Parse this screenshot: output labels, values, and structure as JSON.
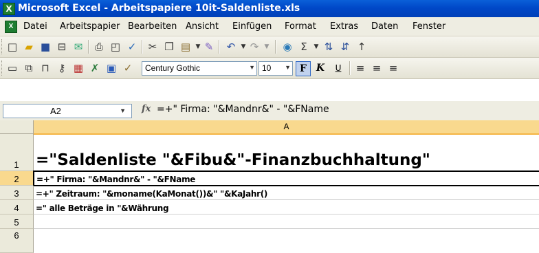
{
  "window": {
    "title": "Microsoft Excel - Arbeitspapiere 10it-Saldenliste.xls",
    "app_logo": "X",
    "doc_logo": "X"
  },
  "menu": [
    "Datei",
    "Arbeitspapier",
    "Bearbeiten",
    "Ansicht",
    "Einfügen",
    "Format",
    "Extras",
    "Daten",
    "Fenster"
  ],
  "toolbar_standard": {
    "icons": [
      "new-icon",
      "open-icon",
      "save-icon",
      "permission-icon",
      "email-icon",
      "print-icon",
      "print-preview-icon",
      "spelling-icon",
      "cut-icon",
      "copy-icon",
      "paste-icon",
      "format-painter-icon",
      "undo-icon",
      "redo-icon",
      "hyperlink-icon",
      "autosum-icon",
      "sort-asc-icon",
      "sort-desc-icon"
    ],
    "autosum_glyph": "Σ"
  },
  "toolbar_format": {
    "font_name": "Century Gothic",
    "font_size": "10",
    "bold": "F",
    "italic": "K",
    "underline": "U"
  },
  "formula_bar": {
    "name_box": "A2",
    "fx": "fx",
    "formula": "=+\" Firma: \"&Mandnr&\" - \"&FName"
  },
  "sheet": {
    "column_headers": [
      "A"
    ],
    "rows": [
      {
        "num": "1",
        "value": "=\"Saldenliste \"&Fibu&\"-Finanzbuchhaltung\""
      },
      {
        "num": "2",
        "value": "=+\" Firma: \"&Mandnr&\" - \"&FName"
      },
      {
        "num": "3",
        "value": "=+\" Zeitraum: \"&moname(KaMonat())&\" \"&KaJahr()"
      },
      {
        "num": "4",
        "value": "=\" alle Beträge in \"&Währung"
      },
      {
        "num": "5",
        "value": ""
      },
      {
        "num": "6",
        "value": ""
      }
    ],
    "selected_cell": "A2"
  }
}
